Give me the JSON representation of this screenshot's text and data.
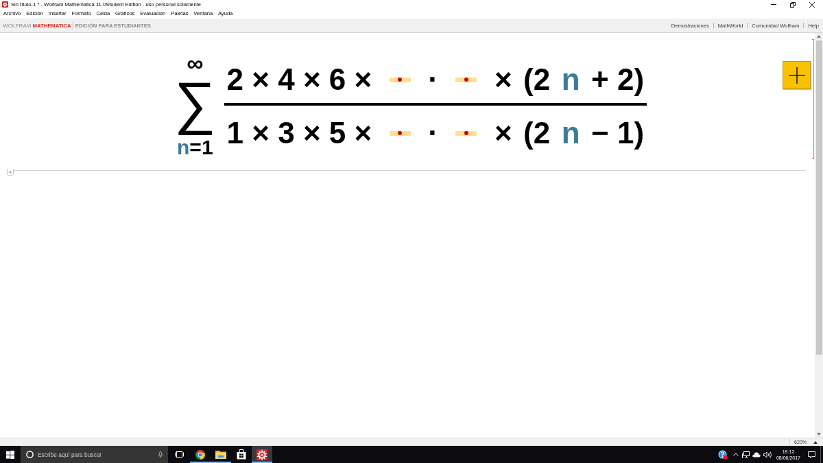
{
  "window": {
    "title": "Sin título-1 * - Wolfram Mathematica 11.0Student Edition - uso personal solamente"
  },
  "menu": [
    "Archivo",
    "Edición",
    "Insertar",
    "Formato",
    "Celda",
    "Gráficos",
    "Evaluación",
    "Paletas",
    "Ventana",
    "Ayuda"
  ],
  "brand_bar": {
    "wolfram": "WOLFRAM",
    "mathematica": "MATHEMATICA",
    "edition": "EDICIÓN PARA ESTUDIANTES",
    "links": [
      "Demostraciones",
      "MathWorld",
      "Comunidad Wolfram",
      "Help"
    ]
  },
  "notebook": {
    "cell": {
      "sum": {
        "symbol": "∑",
        "upper": "∞",
        "lower": [
          {
            "kind": "variable",
            "text": "n"
          },
          {
            "kind": "text",
            "text": "=1"
          }
        ]
      },
      "numerator": [
        {
          "kind": "text",
          "text": "2 × 4 × 6 ×"
        },
        {
          "kind": "slot"
        },
        {
          "kind": "text",
          "text": "·"
        },
        {
          "kind": "slot"
        },
        {
          "kind": "text",
          "text": "×"
        },
        {
          "kind": "text",
          "text": "(2"
        },
        {
          "kind": "variable",
          "text": "n"
        },
        {
          "kind": "text",
          "text": "+ 2)"
        }
      ],
      "denominator": [
        {
          "kind": "text",
          "text": "1 × 3 × 5 ×"
        },
        {
          "kind": "slot"
        },
        {
          "kind": "text",
          "text": "·"
        },
        {
          "kind": "slot"
        },
        {
          "kind": "text",
          "text": "×"
        },
        {
          "kind": "text",
          "text": "(2"
        },
        {
          "kind": "variable",
          "text": "n"
        },
        {
          "kind": "text",
          "text": "− 1)"
        }
      ]
    }
  },
  "status_bar": {
    "zoom": "620%"
  },
  "taskbar": {
    "search": {
      "placeholder": "Escribe aquí para buscar"
    },
    "apps": [
      {
        "kind": "browser",
        "running": true,
        "selected": false
      },
      {
        "kind": "folder",
        "running": true,
        "selected": false
      },
      {
        "kind": "store",
        "running": false,
        "selected": false
      },
      {
        "kind": "mathematica",
        "running": true,
        "selected": true
      }
    ],
    "clock": {
      "time": "19:12",
      "date": "08/06/2017"
    }
  }
}
